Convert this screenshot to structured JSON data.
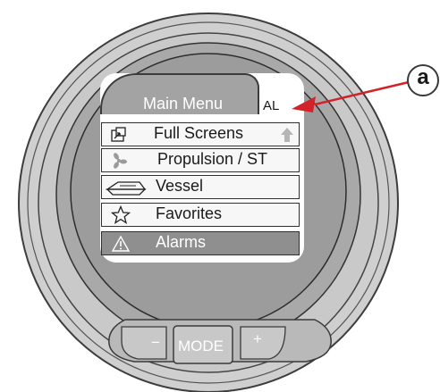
{
  "screen": {
    "header_title": "Main Menu",
    "header_badge": "AL"
  },
  "menu": {
    "items": [
      {
        "label": "Full Screens",
        "icon": "full-screens-icon",
        "trailing_icon": "up-arrow-icon"
      },
      {
        "label": "Propulsion / ST",
        "icon": "propeller-icon"
      },
      {
        "label": "Vessel",
        "icon": "boat-icon"
      },
      {
        "label": "Favorites",
        "icon": "star-icon"
      },
      {
        "label": "Alarms",
        "icon": "warning-icon",
        "selected": true
      }
    ]
  },
  "buttons": {
    "minus": "−",
    "mode": "MODE",
    "plus": "+"
  },
  "callout": {
    "letter": "a",
    "color": "#d2232a"
  },
  "colors": {
    "bezel": "#cfcfcf",
    "tab": "#a3a3a3",
    "selected_row": "#8f8f8f",
    "button": "#c8c8c8"
  }
}
